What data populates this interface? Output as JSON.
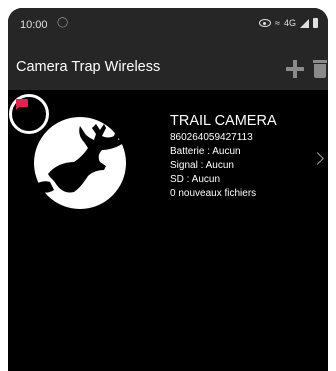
{
  "status_bar": {
    "time": "10:00",
    "left_icon": "notification-icon",
    "right_icons": [
      "eye-icon",
      "wifi-icon",
      "signal-4g-icon",
      "battery-icon"
    ],
    "network_label": "4G"
  },
  "app_bar": {
    "title": "Camera Trap Wireless",
    "actions": [
      "add-icon",
      "trash-icon"
    ]
  },
  "camera": {
    "flag_color": "#e8204e",
    "thumbnail_icon": "deer-silhouette-icon",
    "name": "TRAIL CAMERA",
    "id": "860264059427113",
    "battery": "Batterie : Aucun",
    "signal": "Signal : Aucun",
    "sd": "SD : Aucun",
    "new_files": "0 nouveaux fichiers"
  },
  "colors": {
    "bar_background": "#262626",
    "screen_background": "#000000",
    "flag": "#e8204e",
    "icon_grey": "#8a8a8a"
  }
}
